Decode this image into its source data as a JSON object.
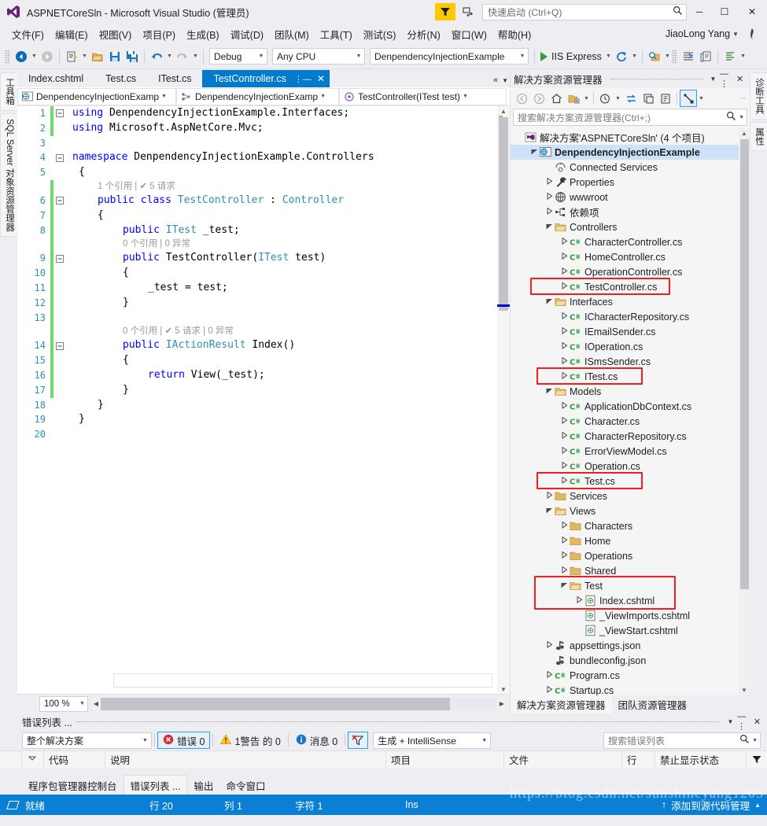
{
  "window": {
    "title": "ASPNETCoreSln - Microsoft Visual Studio (管理员)",
    "logo_icon": "visual-studio-logo",
    "minimize_label": "─",
    "maximize_label": "☐",
    "close_label": "✕"
  },
  "quick_launch": {
    "placeholder": "快速启动 (Ctrl+Q)",
    "icon": "search-icon"
  },
  "titlebar_buttons": {
    "feedback_icon": "feedback-funnel-icon",
    "notify_icon": "notification-icon"
  },
  "menu": {
    "items": [
      "文件(F)",
      "编辑(E)",
      "视图(V)",
      "项目(P)",
      "生成(B)",
      "调试(D)",
      "团队(M)",
      "工具(T)",
      "测试(S)",
      "分析(N)",
      "窗口(W)",
      "帮助(H)"
    ],
    "user": "JiaoLong Yang"
  },
  "toolbar": {
    "nav_back_icon": "navigate-back-icon",
    "nav_forward_icon": "navigate-forward-icon",
    "new_item_icon": "new-item-icon",
    "open_icon": "open-file-icon",
    "save_icon": "save-icon",
    "save_all_icon": "save-all-icon",
    "undo_icon": "undo-icon",
    "redo_icon": "redo-icon",
    "config_value": "Debug",
    "platform_value": "Any CPU",
    "startup_project_value": "DenpendencyInjectionExample",
    "run_label": "IIS Express",
    "run_icon": "play-icon",
    "refresh_icon": "refresh-icon",
    "find_icon": "find-in-files-icon",
    "indent_icon": "indent-icon",
    "comment_icon": "comment-icon",
    "format_icon": "format-document-icon"
  },
  "left_dock_tabs": [
    "工具箱",
    "SQL Server 对象资源管理器"
  ],
  "right_dock_tabs": [
    "诊断工具",
    "属性"
  ],
  "editor": {
    "tabs": [
      {
        "label": "Index.cshtml",
        "active": false
      },
      {
        "label": "Test.cs",
        "active": false
      },
      {
        "label": "ITest.cs",
        "active": false
      },
      {
        "label": "TestController.cs",
        "active": true,
        "pin_icon": "pin-icon",
        "close_icon": "close-icon"
      }
    ],
    "tabstrip_overflow_icon": "chevron-double-left-icon",
    "tabstrip_dropdown_icon": "chevron-down-icon",
    "navbar": [
      {
        "icon": "project-web-icon",
        "label": "DenpendencyInjectionExamp"
      },
      {
        "icon": "namespace-icon",
        "label": "DenpendencyInjectionExamp"
      },
      {
        "icon": "method-icon",
        "label": "TestController(ITest test)"
      }
    ],
    "lines": [
      {
        "n": "1",
        "fold": "minus",
        "change": "green",
        "tokens": [
          {
            "t": "using ",
            "c": "kw"
          },
          {
            "t": "DenpendencyInjectionExample.Interfaces;",
            "c": "pl"
          }
        ],
        "indent": 0
      },
      {
        "n": "2",
        "fold": "",
        "change": "green",
        "tokens": [
          {
            "t": "using ",
            "c": "kw"
          },
          {
            "t": "Microsoft.AspNetCore.Mvc;",
            "c": "pl"
          }
        ],
        "indent": 0
      },
      {
        "n": "3",
        "fold": "",
        "change": "",
        "tokens": [],
        "indent": 0
      },
      {
        "n": "4",
        "fold": "minus",
        "change": "",
        "tokens": [
          {
            "t": "namespace ",
            "c": "kw"
          },
          {
            "t": "DenpendencyInjectionExample.Controllers",
            "c": "pl"
          }
        ],
        "indent": 0
      },
      {
        "n": "5",
        "fold": "",
        "change": "",
        "tokens": [
          {
            "t": "{",
            "c": "pl"
          }
        ],
        "indent": 1
      },
      {
        "n": "",
        "fold": "",
        "change": "green",
        "lens": "1 个引用 | ✔ 5 请求",
        "indent": 4
      },
      {
        "n": "6",
        "fold": "minus",
        "change": "green",
        "tokens": [
          {
            "t": "public class ",
            "c": "kw"
          },
          {
            "t": "TestController",
            "c": "ty"
          },
          {
            "t": " : ",
            "c": "pl"
          },
          {
            "t": "Controller",
            "c": "ty"
          }
        ],
        "indent": 4
      },
      {
        "n": "7",
        "fold": "",
        "change": "green",
        "tokens": [
          {
            "t": "{",
            "c": "pl"
          }
        ],
        "indent": 4
      },
      {
        "n": "8",
        "fold": "",
        "change": "green",
        "tokens": [
          {
            "t": "public ",
            "c": "kw"
          },
          {
            "t": "ITest",
            "c": "ty"
          },
          {
            "t": " _test;",
            "c": "pl"
          }
        ],
        "indent": 8
      },
      {
        "n": "",
        "fold": "",
        "change": "green",
        "lens": "0 个引用 | 0 异常",
        "indent": 8
      },
      {
        "n": "9",
        "fold": "minus",
        "change": "green",
        "tokens": [
          {
            "t": "public ",
            "c": "kw"
          },
          {
            "t": "TestController(",
            "c": "pl"
          },
          {
            "t": "ITest",
            "c": "ty"
          },
          {
            "t": " test)",
            "c": "pl"
          }
        ],
        "indent": 8
      },
      {
        "n": "10",
        "fold": "",
        "change": "green",
        "tokens": [
          {
            "t": "{",
            "c": "pl"
          }
        ],
        "indent": 8
      },
      {
        "n": "11",
        "fold": "",
        "change": "green",
        "tokens": [
          {
            "t": "_test = test;",
            "c": "pl"
          }
        ],
        "indent": 12
      },
      {
        "n": "12",
        "fold": "",
        "change": "green",
        "tokens": [
          {
            "t": "}",
            "c": "pl"
          }
        ],
        "indent": 8
      },
      {
        "n": "13",
        "fold": "",
        "change": "green",
        "tokens": [],
        "indent": 0
      },
      {
        "n": "",
        "fold": "",
        "change": "green",
        "lens": "0 个引用 | ✔ 5 请求 | 0 异常",
        "indent": 8
      },
      {
        "n": "14",
        "fold": "minus",
        "change": "green",
        "tokens": [
          {
            "t": "public ",
            "c": "kw"
          },
          {
            "t": "IActionResult",
            "c": "ty"
          },
          {
            "t": " Index()",
            "c": "pl"
          }
        ],
        "indent": 8
      },
      {
        "n": "15",
        "fold": "",
        "change": "green",
        "tokens": [
          {
            "t": "{",
            "c": "pl"
          }
        ],
        "indent": 8
      },
      {
        "n": "16",
        "fold": "",
        "change": "green",
        "tokens": [
          {
            "t": "return ",
            "c": "kw"
          },
          {
            "t": "View(_test);",
            "c": "pl"
          }
        ],
        "indent": 12
      },
      {
        "n": "17",
        "fold": "",
        "change": "green",
        "tokens": [
          {
            "t": "}",
            "c": "pl"
          }
        ],
        "indent": 8
      },
      {
        "n": "18",
        "fold": "",
        "change": "",
        "tokens": [
          {
            "t": "}",
            "c": "pl"
          }
        ],
        "indent": 4
      },
      {
        "n": "19",
        "fold": "",
        "change": "",
        "tokens": [
          {
            "t": "}",
            "c": "pl"
          }
        ],
        "indent": 1
      },
      {
        "n": "20",
        "fold": "",
        "change": "",
        "tokens": [],
        "indent": 0
      }
    ],
    "zoom": "100 %"
  },
  "solution_explorer": {
    "title": "解决方案资源管理器",
    "dropdown_icon": "chevron-down-icon",
    "pin_icon": "pin-icon",
    "close_icon": "close-icon",
    "toolbar_icons": [
      "back-icon",
      "forward-icon",
      "home-icon",
      "show-all-files-icon",
      "pending-changes-icon",
      "sync-icon",
      "collapse-all-icon",
      "properties-icon",
      "solution-view-icon"
    ],
    "search_placeholder": "搜索解决方案资源管理器(Ctrl+;)",
    "search_icon": "search-icon",
    "tree": [
      {
        "d": 0,
        "tw": "",
        "icon": "solution-icon",
        "label": "解决方案'ASPNETCoreSln' (4 个项目)",
        "bold": false
      },
      {
        "d": 1,
        "tw": "down",
        "icon": "project-web-icon",
        "label": "DenpendencyInjectionExample",
        "bold": true,
        "sel": true
      },
      {
        "d": 2,
        "tw": "",
        "icon": "connected-services-icon",
        "label": "Connected Services",
        "bold": false
      },
      {
        "d": 2,
        "tw": "right",
        "icon": "properties-wrench-icon",
        "label": "Properties",
        "bold": false
      },
      {
        "d": 2,
        "tw": "right",
        "icon": "wwwroot-globe-icon",
        "label": "wwwroot",
        "bold": false
      },
      {
        "d": 2,
        "tw": "right",
        "icon": "dependencies-icon",
        "label": "依赖项",
        "bold": false
      },
      {
        "d": 2,
        "tw": "down",
        "icon": "folder-open-icon",
        "label": "Controllers",
        "bold": false
      },
      {
        "d": 3,
        "tw": "right",
        "icon": "csharp-file-icon",
        "label": "CharacterController.cs",
        "bold": false
      },
      {
        "d": 3,
        "tw": "right",
        "icon": "csharp-file-icon",
        "label": "HomeController.cs",
        "bold": false
      },
      {
        "d": 3,
        "tw": "right",
        "icon": "csharp-file-icon",
        "label": "OperationController.cs",
        "bold": false
      },
      {
        "d": 3,
        "tw": "right",
        "icon": "csharp-file-icon",
        "label": "TestController.cs",
        "bold": false,
        "hl": "wide"
      },
      {
        "d": 2,
        "tw": "down",
        "icon": "folder-open-icon",
        "label": "Interfaces",
        "bold": false
      },
      {
        "d": 3,
        "tw": "right",
        "icon": "csharp-file-icon",
        "label": "ICharacterRepository.cs",
        "bold": false
      },
      {
        "d": 3,
        "tw": "right",
        "icon": "csharp-file-icon",
        "label": "IEmailSender.cs",
        "bold": false
      },
      {
        "d": 3,
        "tw": "right",
        "icon": "csharp-file-icon",
        "label": "IOperation.cs",
        "bold": false
      },
      {
        "d": 3,
        "tw": "right",
        "icon": "csharp-file-icon",
        "label": "ISmsSender.cs",
        "bold": false
      },
      {
        "d": 3,
        "tw": "right",
        "icon": "csharp-file-icon",
        "label": "ITest.cs",
        "bold": false,
        "hl": "narrow"
      },
      {
        "d": 2,
        "tw": "down",
        "icon": "folder-open-icon",
        "label": "Models",
        "bold": false
      },
      {
        "d": 3,
        "tw": "right",
        "icon": "csharp-file-icon",
        "label": "ApplicationDbContext.cs",
        "bold": false
      },
      {
        "d": 3,
        "tw": "right",
        "icon": "csharp-file-icon",
        "label": "Character.cs",
        "bold": false
      },
      {
        "d": 3,
        "tw": "right",
        "icon": "csharp-file-icon",
        "label": "CharacterRepository.cs",
        "bold": false
      },
      {
        "d": 3,
        "tw": "right",
        "icon": "csharp-file-icon",
        "label": "ErrorViewModel.cs",
        "bold": false
      },
      {
        "d": 3,
        "tw": "right",
        "icon": "csharp-file-icon",
        "label": "Operation.cs",
        "bold": false
      },
      {
        "d": 3,
        "tw": "right",
        "icon": "csharp-file-icon",
        "label": "Test.cs",
        "bold": false,
        "hl": "narrow"
      },
      {
        "d": 2,
        "tw": "right",
        "icon": "folder-icon",
        "label": "Services",
        "bold": false
      },
      {
        "d": 2,
        "tw": "down",
        "icon": "folder-open-icon",
        "label": "Views",
        "bold": false
      },
      {
        "d": 3,
        "tw": "right",
        "icon": "folder-icon",
        "label": "Characters",
        "bold": false
      },
      {
        "d": 3,
        "tw": "right",
        "icon": "folder-icon",
        "label": "Home",
        "bold": false
      },
      {
        "d": 3,
        "tw": "right",
        "icon": "folder-icon",
        "label": "Operations",
        "bold": false
      },
      {
        "d": 3,
        "tw": "right",
        "icon": "folder-icon",
        "label": "Shared",
        "bold": false
      },
      {
        "d": 3,
        "tw": "down",
        "icon": "folder-open-icon",
        "label": "Test",
        "bold": false,
        "hl": "group-start"
      },
      {
        "d": 4,
        "tw": "right",
        "icon": "cshtml-file-icon",
        "label": "Index.cshtml",
        "bold": false,
        "hl": "group-end"
      },
      {
        "d": 4,
        "tw": "",
        "icon": "cshtml-file-icon",
        "label": "_ViewImports.cshtml",
        "bold": false
      },
      {
        "d": 4,
        "tw": "",
        "icon": "cshtml-file-icon",
        "label": "_ViewStart.cshtml",
        "bold": false
      },
      {
        "d": 2,
        "tw": "right",
        "icon": "json-file-icon",
        "label": "appsettings.json",
        "bold": false
      },
      {
        "d": 2,
        "tw": "",
        "icon": "json-file-icon",
        "label": "bundleconfig.json",
        "bold": false
      },
      {
        "d": 2,
        "tw": "right",
        "icon": "csharp-file-icon",
        "label": "Program.cs",
        "bold": false
      },
      {
        "d": 2,
        "tw": "right",
        "icon": "csharp-file-icon",
        "label": "Startup.cs",
        "bold": false
      }
    ],
    "bottom_tabs": [
      {
        "label": "解决方案资源管理器",
        "active": true
      },
      {
        "label": "团队资源管理器",
        "active": false
      }
    ]
  },
  "error_list": {
    "title": "错误列表 ...",
    "dropdown_icon": "chevron-down-icon",
    "pin_icon": "pin-icon",
    "close_icon": "close-icon",
    "scope_value": "整个解决方案",
    "errors_label": "错误 0",
    "warnings_label": "1警告 的 0",
    "messages_label": "消息 0",
    "filter_icon": "clear-filter-icon",
    "build_filter_value": "生成 + IntelliSense",
    "search_placeholder": "搜索错误列表",
    "search_icon": "search-icon",
    "columns": [
      "",
      "",
      "代码",
      "说明",
      "项目",
      "文件",
      "行",
      "禁止显示状态"
    ],
    "sort_icon": "filter-icon"
  },
  "panel_tabs": [
    {
      "label": "程序包管理器控制台",
      "active": false
    },
    {
      "label": "错误列表 ...",
      "active": true
    },
    {
      "label": "输出",
      "active": false
    },
    {
      "label": "命令窗口",
      "active": false
    }
  ],
  "status_bar": {
    "state": "就绪",
    "line": "行 20",
    "col": "列 1",
    "char": "字符 1",
    "ins": "Ins",
    "source_control": "添加到源代码管理",
    "source_control_icon": "upload-arrow-icon",
    "expand_icon": "chevron-up-icon"
  },
  "watermark": "https://blog.csdn.net/sunshineyang1205",
  "colors": {
    "accent": "#007acc",
    "status_bar": "#0b7fd4",
    "chrome": "#eeeef2",
    "keyword": "#0000ff",
    "type": "#2b91af",
    "highlight_box": "#f01e1e",
    "changebar_green": "#6ed96e",
    "selection": "#cee2f7"
  }
}
